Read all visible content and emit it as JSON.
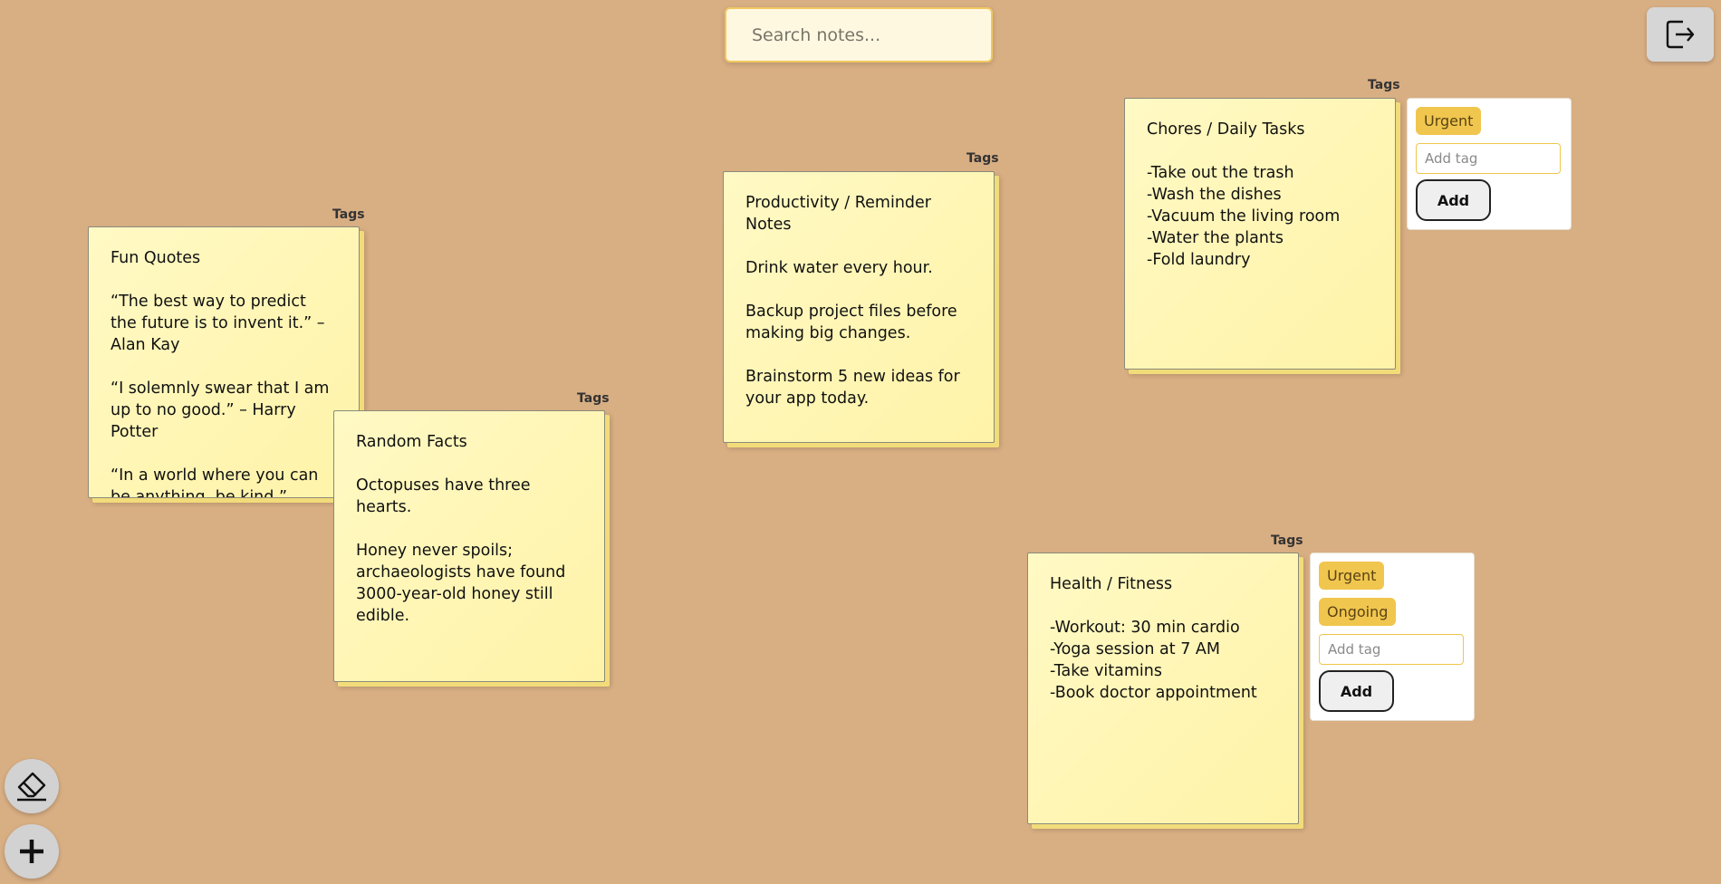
{
  "search": {
    "placeholder": "Search notes..."
  },
  "tags_label": "Tags",
  "notes": [
    {
      "id": "fun-quotes",
      "text": "Fun Quotes\n\n“The best way to predict the future is to invent it.” – Alan Kay\n\n“I solemnly swear that I am up to no good.” – Harry Potter\n\n“In a world where you can be anything, be kind.”"
    },
    {
      "id": "random-facts",
      "text": "Random Facts\n\nOctopuses have three hearts.\n\nHoney never spoils; archaeologists have found 3000-year-old honey still edible."
    },
    {
      "id": "productivity",
      "text": "Productivity / Reminder Notes\n\nDrink water every hour.\n\nBackup project files before making big changes.\n\nBrainstorm 5 new ideas for your app today."
    },
    {
      "id": "chores",
      "text": "Chores / Daily Tasks\n\n-Take out the trash\n-Wash the dishes\n-Vacuum the living room\n-Water the plants\n-Fold laundry"
    },
    {
      "id": "health",
      "text": "Health / Fitness\n\n-Workout: 30 min cardio\n-Yoga session at 7 AM\n-Take vitamins\n-Book doctor appointment"
    }
  ],
  "tag_panels": {
    "chores": {
      "tags": [
        "Urgent"
      ],
      "input_placeholder": "Add tag",
      "add_label": "Add"
    },
    "health": {
      "tags": [
        "Urgent",
        "Ongoing"
      ],
      "input_placeholder": "Add tag",
      "add_label": "Add"
    }
  },
  "icons": {
    "logout": "logout-icon",
    "eraser": "eraser-icon",
    "plus": "plus-icon"
  },
  "colors": {
    "background": "#d8ae83",
    "note": "#fff6b8",
    "tag_chip": "#f0c64e",
    "search_border": "#f0c860"
  }
}
